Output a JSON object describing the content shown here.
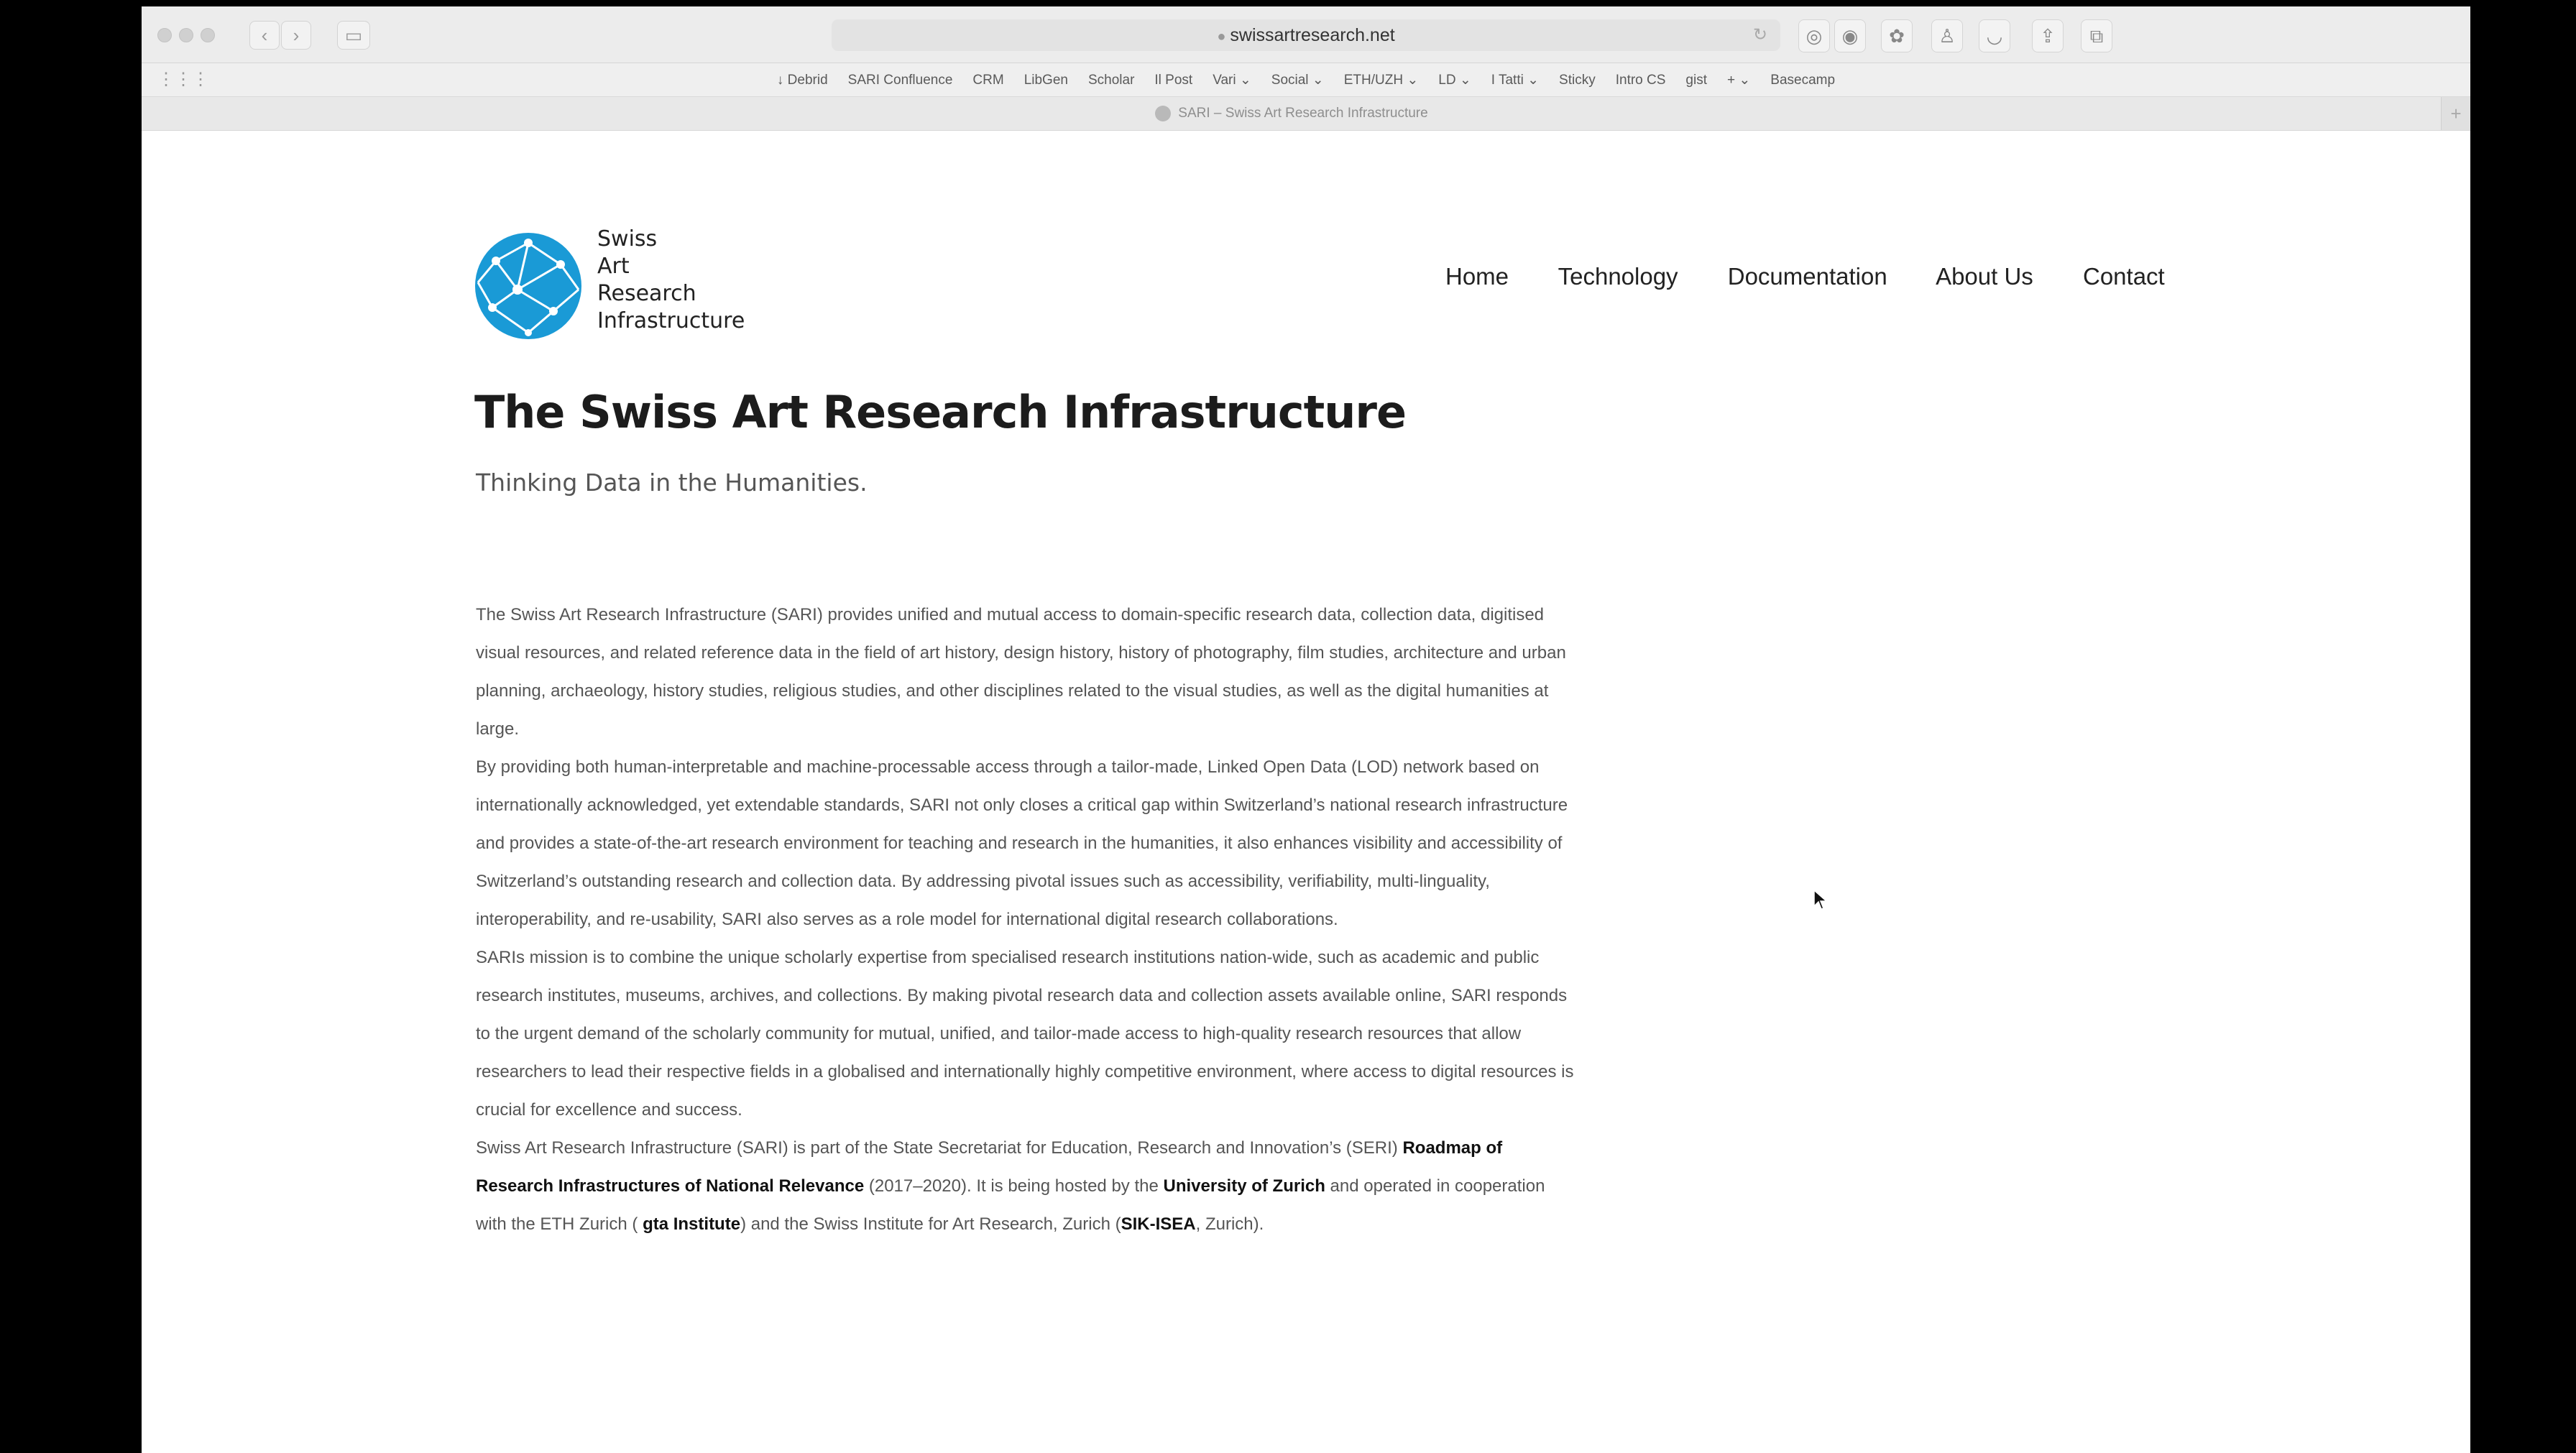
{
  "browser": {
    "address": "swissartresearch.net",
    "tab_title": "SARI – Swiss Art Research Infrastructure",
    "back_icon": "‹",
    "forward_icon": "›",
    "favorites": [
      "↓ Debrid",
      "SARI Confluence",
      "CRM",
      "LibGen",
      "Scholar",
      "Il Post",
      "Vari ⌄",
      "Social ⌄",
      "ETH/UZH ⌄",
      "LD ⌄",
      "I Tatti ⌄",
      "Sticky",
      "Intro CS",
      "gist",
      "+ ⌄",
      "Basecamp"
    ]
  },
  "site": {
    "logo_lines": [
      "Swiss",
      "Art",
      "Research",
      "Infrastructure"
    ],
    "logo_color": "#1a9ad6",
    "nav": [
      "Home",
      "Technology",
      "Documentation",
      "About Us",
      "Contact"
    ],
    "title": "The Swiss Art Research Infrastructure",
    "subtitle": "Thinking Data in the Humanities.",
    "p1": "The Swiss Art Research Infrastructure (SARI) provides unified and mutual access to domain-specific research data, collection data, digitised visual resources, and related reference data in the field of art history, design history, history of photography, film studies, architecture and urban planning, archaeology, history studies, religious studies, and other disciplines related to the visual studies, as well as the digital humanities at large.",
    "p2": "By providing both human-interpretable and machine-processable access through a tailor-made, Linked Open Data (LOD) network based on internationally acknowledged, yet extendable standards, SARI not only closes a critical gap within Switzerland’s national research infrastructure and provides a state-of-the-art research environment for teaching and research in the humanities, it also enhances visibility and accessibility of Switzerland’s outstanding research and collection data. By addressing pivotal issues such as accessibility, verifiability, multi-linguality, interoperability, and re-usability, SARI also serves as a role model for international digital research collaborations.",
    "p3": "SARIs mission is to combine the unique scholarly expertise from specialised research institutions nation-wide, such as academic and public research institutes, museums, archives, and collections. By making pivotal research data and collection assets available online, SARI responds to the urgent demand of the scholarly community for mutual, unified, and tailor-made access to high-quality research resources that allow researchers to lead their respective fields in a globalised and internationally highly competitive environment, where access to digital resources is crucial for excellence and success.",
    "p4": {
      "t1": "Swiss Art Research Infrastructure (SARI) is part of the State Secretariat for Education, Research and Innovation’s (SERI) ",
      "link1": "Roadmap of Research Infrastructures of National Relevance",
      "t2": " (2017–2020). It is being hosted by the ",
      "link2": "University of Zurich",
      "t3": " and operated in cooperation with the ETH Zurich ( ",
      "link3": "gta Institute",
      "t4": ") and the Swiss Institute for Art Research, Zurich (",
      "link4": "SIK-ISEA",
      "t5": ", Zurich)."
    }
  }
}
